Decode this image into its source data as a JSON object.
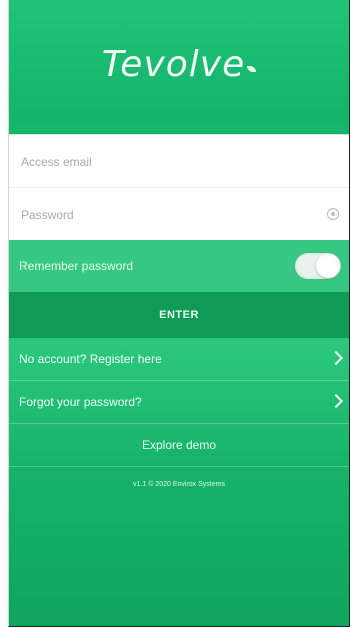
{
  "app": {
    "logo_text": "Tevolve"
  },
  "login": {
    "email_placeholder": "Access email",
    "password_placeholder": "Password",
    "remember_label": "Remember password",
    "remember_toggle_on": true,
    "enter_label": "ENTER"
  },
  "links": {
    "register": "No account? Register here",
    "forgot": "Forgot your password?",
    "explore": "Explore demo"
  },
  "footer": {
    "version": "v1.1 © 2020 Envirox Systems"
  },
  "colors": {
    "primary": "#1ab870",
    "button": "#0f9a55"
  },
  "icons": {
    "password_toggle": "eye-icon",
    "link_arrow": "chevron-right-icon"
  }
}
